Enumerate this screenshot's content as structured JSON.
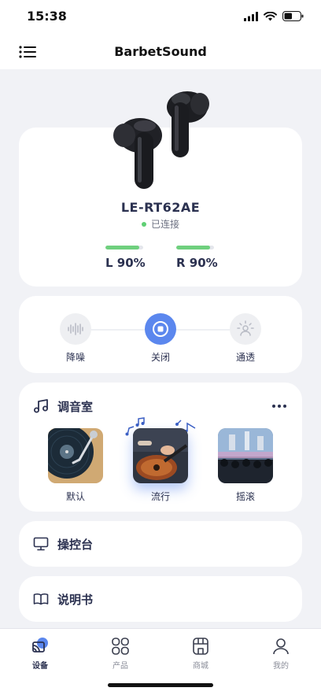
{
  "status_bar": {
    "time": "15:38",
    "battery_level": 0.5
  },
  "app_bar": {
    "title": "BarbetSound"
  },
  "device": {
    "model": "LE-RT62AE",
    "connection_status": "已连接",
    "left": {
      "label": "L 90%",
      "level": 0.9
    },
    "right": {
      "label": "R 90%",
      "level": 0.9
    }
  },
  "modes": {
    "items": [
      {
        "label": "降噪",
        "icon": "noise-cancel-icon",
        "active": false
      },
      {
        "label": "关闭",
        "icon": "stop-icon",
        "active": true
      },
      {
        "label": "通透",
        "icon": "transparency-icon",
        "active": false
      }
    ]
  },
  "eq": {
    "title": "调音室",
    "presets": [
      {
        "label": "默认",
        "image": "turntable-vinyl",
        "selected": false
      },
      {
        "label": "流行",
        "image": "guitar-player",
        "selected": true
      },
      {
        "label": "摇滚",
        "image": "concert-crowd",
        "selected": false
      }
    ]
  },
  "menu_items": [
    {
      "label": "操控台",
      "icon": "monitor-icon"
    },
    {
      "label": "说明书",
      "icon": "book-icon"
    }
  ],
  "tabs": [
    {
      "label": "设备",
      "icon": "device-icon",
      "active": true
    },
    {
      "label": "产品",
      "icon": "grid-icon",
      "active": false
    },
    {
      "label": "商城",
      "icon": "store-icon",
      "active": false
    },
    {
      "label": "我的",
      "icon": "user-icon",
      "active": false
    }
  ],
  "colors": {
    "accent": "#5b87ee",
    "battery": "#6fd07e",
    "connected": "#5fcf74",
    "text": "#2b3150"
  }
}
